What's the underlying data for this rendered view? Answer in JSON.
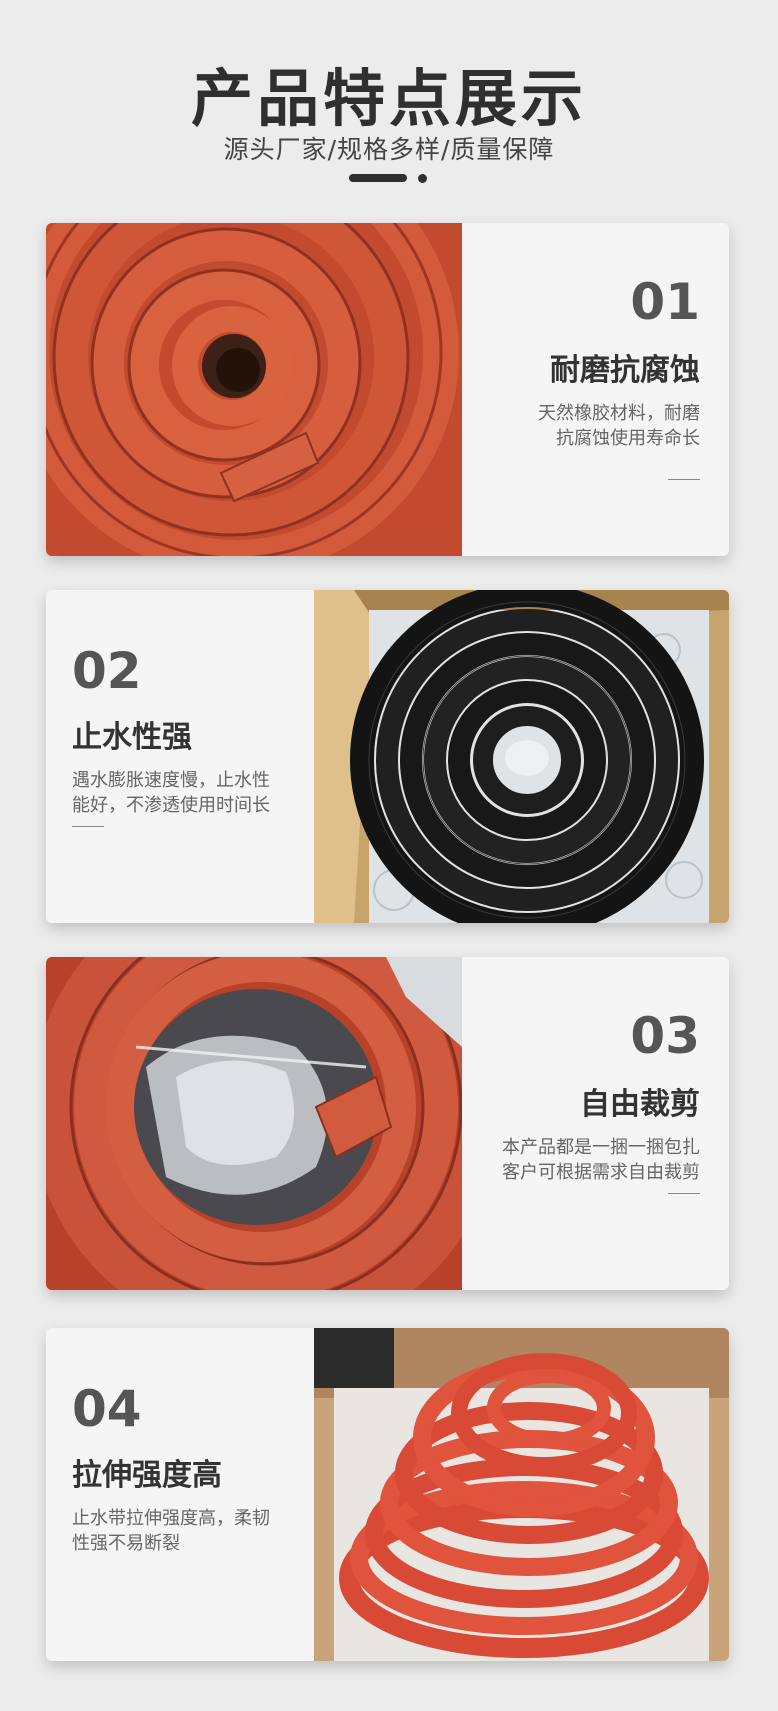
{
  "header": {
    "title": "产品特点展示",
    "subtitle": "源头厂家/规格多样/质量保障"
  },
  "features": [
    {
      "number": "01",
      "title": "耐磨抗腐蚀",
      "desc_line1": "天然橡胶材料，耐磨",
      "desc_line2": "抗腐蚀使用寿命长",
      "photo": "red-rubber-strip-coil"
    },
    {
      "number": "02",
      "title": "止水性强",
      "desc_line1": "遇水膨胀速度慢，止水性",
      "desc_line2": "能好，不渗透使用时间长",
      "photo": "black-rubber-strip-coil-in-box"
    },
    {
      "number": "03",
      "title": "自由裁剪",
      "desc_line1": "本产品都是一捆一捆包扎",
      "desc_line2": "客户可根据需求自由裁剪",
      "photo": "red-rubber-strip-coil-with-plastic"
    },
    {
      "number": "04",
      "title": "拉伸强度高",
      "desc_line1": "止水带拉伸强度高，柔韧",
      "desc_line2": "性强不易断裂",
      "photo": "red-rubber-ring-stack"
    }
  ],
  "colors": {
    "background": "#ececec",
    "card": "#f5f5f5",
    "rubber_red": "#c8482c",
    "rubber_black": "#1c1c1c"
  }
}
